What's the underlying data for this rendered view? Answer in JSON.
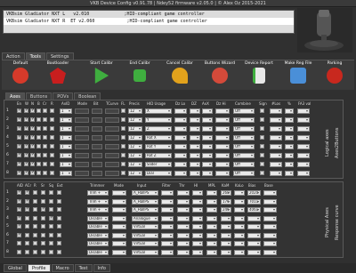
{
  "title": "VKB Device Config v0.91.78 | Ndey52 firmware v2.05.0 | © Alex Oz 2015-2021",
  "devices": [
    "VKBsim Gladiator NXT L   v2.010             ;HID-compliant game controller",
    "VKBsim Gladiator NXT R  ET v2.060            ;HID-compliant game controller"
  ],
  "top_tabs": [
    "Action",
    "Tools",
    "Settings"
  ],
  "toolbar": {
    "default": "Default",
    "bootloader": "Bootloader",
    "start_calibr": "Start Calibr",
    "end_calibr": "End Calibr",
    "cancel_calibr": "Cancel Calibr",
    "buttons_wizard": "Buttons Wizard",
    "device_report": "Device Report",
    "make_reg_file": "Make Reg File",
    "parking": "Parking"
  },
  "sub_tabs": [
    "Axes",
    "Buttons",
    "POVs",
    "Boolean"
  ],
  "axes_headers": {
    "en": "En",
    "w": "W",
    "n": "N",
    "b": "B",
    "cr": "Cr",
    "r": "R",
    "axid": "AxID",
    "mode": "Mode",
    "bit": "Bit",
    "tcurve": "TCurve",
    "fl": "FL",
    "precis": "Precis",
    "hid": "HID Usage",
    "dz_lo": "Dz Lo",
    "dz": "DZ",
    "axx": "AxX",
    "dz_hi": "Dz Hi",
    "combine": "Combine",
    "sign": "Sign",
    "nlos": "#Los",
    "pct": "%",
    "fa": "FA3 val"
  },
  "axes_rows": [
    {
      "n": "1",
      "axid": "1",
      "mode": "",
      "bit": "12",
      "hid": "X",
      "combine": "Off"
    },
    {
      "n": "2",
      "axid": "1",
      "mode": "",
      "bit": "12",
      "hid": "Y",
      "combine": "Off"
    },
    {
      "n": "3",
      "axid": "1",
      "mode": "",
      "bit": "12",
      "hid": "Z",
      "combine": "Off"
    },
    {
      "n": "4",
      "axid": "1",
      "mode": "",
      "bit": "12",
      "hid": "Rot X",
      "combine": "Off"
    },
    {
      "n": "5",
      "axid": "1",
      "mode": "",
      "bit": "12",
      "hid": "Rot Y",
      "combine": "Off"
    },
    {
      "n": "6",
      "axid": "1",
      "mode": "",
      "bit": "12",
      "hid": "Rot Z",
      "combine": "Off"
    },
    {
      "n": "7",
      "axid": "1",
      "mode": "",
      "bit": "12",
      "hid": "Slider",
      "combine": "Off"
    },
    {
      "n": "8",
      "axid": "1",
      "mode": "",
      "bit": "12",
      "hid": "Dial",
      "combine": "Off"
    }
  ],
  "side_labels": {
    "logical": "Logical axes",
    "axes2buttons": "Axes2Buttons",
    "physical": "Physical Axes",
    "response": "Response curve"
  },
  "phys_headers": {
    "aid": "AID",
    "acr": "ACr",
    "r": "R",
    "sr": "Sr",
    "sq": "Sq",
    "ext": "Ext",
    "trimmer": "Trimmer",
    "mode": "Mode",
    "input": "Input",
    "filter": "Filter",
    "thr": "Thr",
    "hi": "HI",
    "mpl": "MPL",
    "kam": "KaM",
    "kalo": "KaLo",
    "bias": "Bias",
    "base": "Base"
  },
  "phys_rows": [
    {
      "n": "1",
      "trim": "Trim +",
      "input": "A_HallPS",
      "v1": "268",
      "v2": "2020"
    },
    {
      "n": "2",
      "trim": "Trim +",
      "input": "A_HallPS",
      "v1": "176",
      "v2": "7011"
    },
    {
      "n": "3",
      "trim": "Trim +",
      "input": "A_HallPS",
      "v1": "246",
      "v2": "4061"
    },
    {
      "n": "4",
      "trim": "Disable",
      "input": "Analogue",
      "v1": "",
      "v2": ""
    },
    {
      "n": "5",
      "trim": "Disable",
      "input": "Virtual",
      "v1": "",
      "v2": ""
    },
    {
      "n": "6",
      "trim": "Disable",
      "input": "Virtual",
      "v1": "",
      "v2": ""
    },
    {
      "n": "7",
      "trim": "Disable",
      "input": "Virtual",
      "v1": "",
      "v2": ""
    },
    {
      "n": "8",
      "trim": "Disable",
      "input": "Virtual",
      "v1": "",
      "v2": ""
    }
  ],
  "bottom_tabs": [
    "Global",
    "Profile",
    "Macro",
    "Test",
    "Info"
  ],
  "colors": {
    "default": "#d63a2a",
    "bootloader": "#c81e1e",
    "calib": "#3fae3f",
    "cancel": "#e2a21c",
    "wizard": "#d44a3a",
    "report": "#e8e8e8",
    "regfile": "#4a8fd8",
    "parking": "#c8281e"
  }
}
